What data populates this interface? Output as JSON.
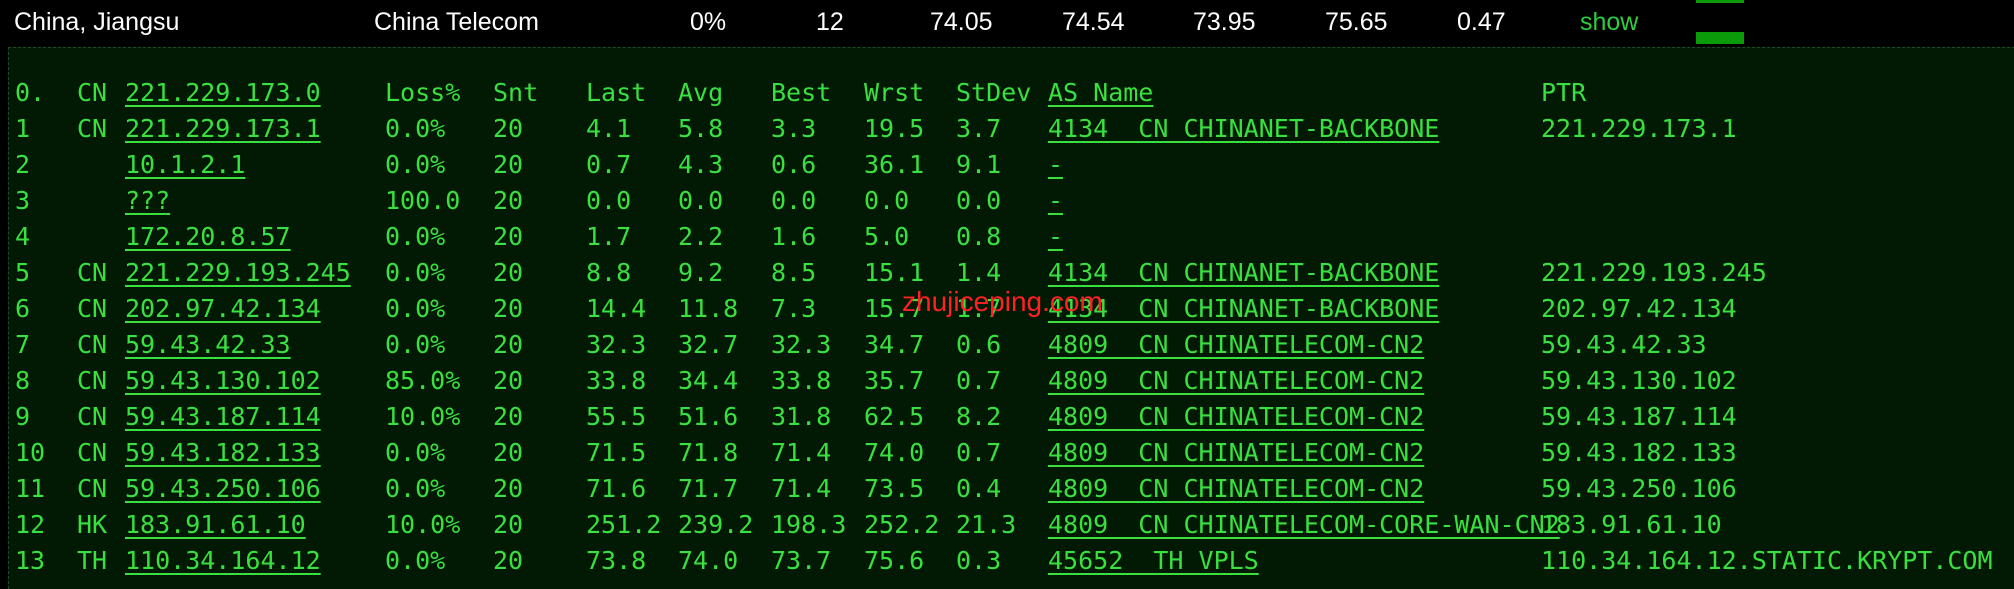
{
  "summary": {
    "location": "China, Jiangsu",
    "isp": "China Telecom",
    "loss": "0%",
    "sent": "12",
    "last": "74.05",
    "avg": "74.54",
    "best": "73.95",
    "worst": "75.65",
    "stdev": "0.47",
    "show_label": "show"
  },
  "headers": [
    "0.",
    "CN",
    "221.229.173.0",
    "Loss%",
    "Snt",
    "Last",
    "Avg",
    "Best",
    "Wrst",
    "StDev",
    "AS Name",
    "PTR"
  ],
  "rows": [
    [
      "1",
      "CN",
      "221.229.173.1",
      "0.0%",
      "20",
      "4.1",
      "5.8",
      "3.3",
      "19.5",
      "3.7",
      "4134  CN CHINANET-BACKBONE",
      "221.229.173.1"
    ],
    [
      "2",
      "",
      "10.1.2.1",
      "0.0%",
      "20",
      "0.7",
      "4.3",
      "0.6",
      "36.1",
      "9.1",
      "-",
      ""
    ],
    [
      "3",
      "",
      "???",
      "100.0",
      "20",
      "0.0",
      "0.0",
      "0.0",
      "0.0",
      "0.0",
      "-",
      ""
    ],
    [
      "4",
      "",
      "172.20.8.57",
      "0.0%",
      "20",
      "1.7",
      "2.2",
      "1.6",
      "5.0",
      "0.8",
      "-",
      ""
    ],
    [
      "5",
      "CN",
      "221.229.193.245",
      "0.0%",
      "20",
      "8.8",
      "9.2",
      "8.5",
      "15.1",
      "1.4",
      "4134  CN CHINANET-BACKBONE",
      "221.229.193.245"
    ],
    [
      "6",
      "CN",
      "202.97.42.134",
      "0.0%",
      "20",
      "14.4",
      "11.8",
      "7.3",
      "15.7",
      "1.7",
      "4134  CN CHINANET-BACKBONE",
      "202.97.42.134"
    ],
    [
      "7",
      "CN",
      "59.43.42.33",
      "0.0%",
      "20",
      "32.3",
      "32.7",
      "32.3",
      "34.7",
      "0.6",
      "4809  CN CHINATELECOM-CN2",
      "59.43.42.33"
    ],
    [
      "8",
      "CN",
      "59.43.130.102",
      "85.0%",
      "20",
      "33.8",
      "34.4",
      "33.8",
      "35.7",
      "0.7",
      "4809  CN CHINATELECOM-CN2",
      "59.43.130.102"
    ],
    [
      "9",
      "CN",
      "59.43.187.114",
      "10.0%",
      "20",
      "55.5",
      "51.6",
      "31.8",
      "62.5",
      "8.2",
      "4809  CN CHINATELECOM-CN2",
      "59.43.187.114"
    ],
    [
      "10",
      "CN",
      "59.43.182.133",
      "0.0%",
      "20",
      "71.5",
      "71.8",
      "71.4",
      "74.0",
      "0.7",
      "4809  CN CHINATELECOM-CN2",
      "59.43.182.133"
    ],
    [
      "11",
      "CN",
      "59.43.250.106",
      "0.0%",
      "20",
      "71.6",
      "71.7",
      "71.4",
      "73.5",
      "0.4",
      "4809  CN CHINATELECOM-CN2",
      "59.43.250.106"
    ],
    [
      "12",
      "HK",
      "183.91.61.10",
      "10.0%",
      "20",
      "251.2",
      "239.2",
      "198.3",
      "252.2",
      "21.3",
      "4809  CN CHINATELECOM-CORE-WAN-CN2",
      "183.91.61.10"
    ],
    [
      "13",
      "TH",
      "110.34.164.12",
      "0.0%",
      "20",
      "73.8",
      "74.0",
      "73.7",
      "75.6",
      "0.3",
      "45652  TH VPLS",
      "110.34.164.12.STATIC.KRYPT.COM"
    ]
  ],
  "watermark": "zhujiceping.com",
  "colors": {
    "text": "#39e03f",
    "background": "#021a04",
    "summary_text": "#ffffff",
    "watermark": "#ff2020"
  }
}
